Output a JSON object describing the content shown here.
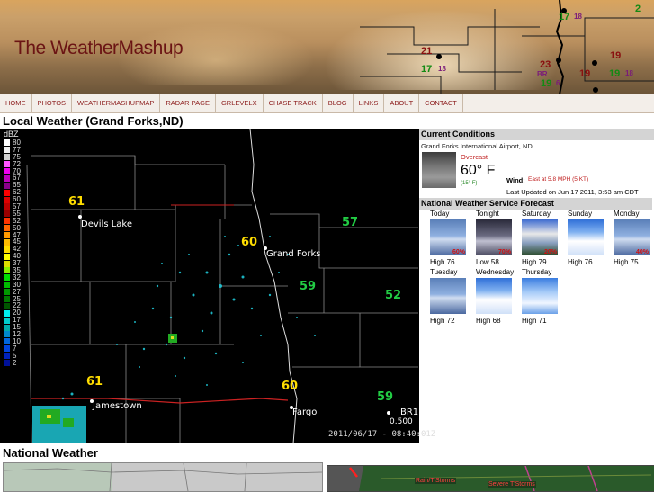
{
  "site": {
    "title": "The WeatherMashup"
  },
  "header_map": {
    "numbers": [
      {
        "text": "21",
        "color": "#8a1010"
      },
      {
        "text": "17",
        "color": "#138a13"
      },
      {
        "text": "18",
        "color": "#7a1a7a"
      },
      {
        "text": "23",
        "color": "#8a1010"
      },
      {
        "text": "BR",
        "color": "#7a1a7a"
      },
      {
        "text": "19",
        "color": "#138a13"
      },
      {
        "text": "6",
        "color": "#7a1a7a"
      },
      {
        "text": "19",
        "color": "#8a1010"
      },
      {
        "text": "19",
        "color": "#8a1010"
      },
      {
        "text": "19",
        "color": "#138a13"
      },
      {
        "text": "18",
        "color": "#7a1a7a"
      },
      {
        "text": "17",
        "color": "#138a13"
      },
      {
        "text": "18",
        "color": "#7a1a7a"
      },
      {
        "text": "2",
        "color": "#138a13"
      }
    ]
  },
  "nav": {
    "items": [
      "HOME",
      "PHOTOS",
      "WEATHERMASHUPMAP",
      "RADAR PAGE",
      "GRLEVELX",
      "CHASE TRACK",
      "BLOG",
      "LINKS",
      "ABOUT",
      "CONTACT"
    ]
  },
  "local": {
    "title": "Local Weather (Grand Forks,ND)",
    "radar": {
      "units": "dBZ",
      "legend": [
        {
          "v": "80",
          "c": "#ffffff"
        },
        {
          "v": "77",
          "c": "#f0f0f0"
        },
        {
          "v": "75",
          "c": "#d0d0d0"
        },
        {
          "v": "72",
          "c": "#ff55ff"
        },
        {
          "v": "70",
          "c": "#ee00ee"
        },
        {
          "v": "67",
          "c": "#bb00bb"
        },
        {
          "v": "65",
          "c": "#880088"
        },
        {
          "v": "62",
          "c": "#ff0000"
        },
        {
          "v": "60",
          "c": "#dd0000"
        },
        {
          "v": "57",
          "c": "#bb0000"
        },
        {
          "v": "55",
          "c": "#990000"
        },
        {
          "v": "52",
          "c": "#ff3300"
        },
        {
          "v": "50",
          "c": "#ff6600"
        },
        {
          "v": "47",
          "c": "#ff9900"
        },
        {
          "v": "45",
          "c": "#ffbb00"
        },
        {
          "v": "42",
          "c": "#ffdd00"
        },
        {
          "v": "40",
          "c": "#ffff00"
        },
        {
          "v": "37",
          "c": "#dddd00"
        },
        {
          "v": "35",
          "c": "#88ee00"
        },
        {
          "v": "32",
          "c": "#00dd00"
        },
        {
          "v": "30",
          "c": "#00bb00"
        },
        {
          "v": "27",
          "c": "#009900"
        },
        {
          "v": "25",
          "c": "#007700"
        },
        {
          "v": "22",
          "c": "#005500"
        },
        {
          "v": "20",
          "c": "#00eeee"
        },
        {
          "v": "17",
          "c": "#00cccc"
        },
        {
          "v": "15",
          "c": "#00aaaa"
        },
        {
          "v": "12",
          "c": "#0088cc"
        },
        {
          "v": "10",
          "c": "#0066dd"
        },
        {
          "v": "7",
          "c": "#0044dd"
        },
        {
          "v": "5",
          "c": "#0022bb"
        },
        {
          "v": "2",
          "c": "#001199"
        }
      ],
      "cities": [
        {
          "name": "Devils Lake"
        },
        {
          "name": "Grand Forks"
        },
        {
          "name": "Jamestown"
        },
        {
          "name": "Fargo"
        },
        {
          "name": "BR1"
        }
      ],
      "temps": [
        {
          "v": "61",
          "color": "#ffdd00"
        },
        {
          "v": "60",
          "color": "#ffdd00"
        },
        {
          "v": "57",
          "color": "#22cc44"
        },
        {
          "v": "59",
          "color": "#22cc44"
        },
        {
          "v": "52",
          "color": "#22cc44"
        },
        {
          "v": "61",
          "color": "#ffdd00"
        },
        {
          "v": "60",
          "color": "#ffdd00"
        },
        {
          "v": "59",
          "color": "#22cc44"
        }
      ],
      "timestamp": "2011/06/17 - 08:40:01Z",
      "extra_label": "0.500"
    }
  },
  "current": {
    "header": "Current Conditions",
    "station": "Grand Forks International Airport, ND",
    "condition": "Overcast",
    "temp": "60° F",
    "temp_c": "(15° F)",
    "wind_label": "Wind:",
    "wind": "East at 5.8 MPH (5 KT)",
    "updated": "Last Updated on Jun 17 2011, 3:53 am CDT"
  },
  "forecast": {
    "header": "National Weather Service Forecast",
    "days": [
      {
        "day": "Today",
        "high": "High 76",
        "pct": "60%",
        "icon": "thunderstorm-icon"
      },
      {
        "day": "Tonight",
        "high": "Low 58",
        "pct": "70%",
        "icon": "night-thunderstorm-icon"
      },
      {
        "day": "Saturday",
        "high": "High 79",
        "pct": "20%",
        "icon": "partly-cloudy-storm-icon"
      },
      {
        "day": "Sunday",
        "high": "High 76",
        "pct": "",
        "icon": "partly-cloudy-icon"
      },
      {
        "day": "Monday",
        "high": "High 75",
        "pct": "40%",
        "icon": "thunderstorm-icon"
      },
      {
        "day": "Tuesday",
        "high": "High 72",
        "pct": "",
        "icon": "thunderstorm-icon"
      },
      {
        "day": "Wednesday",
        "high": "High 68",
        "pct": "",
        "icon": "partly-cloudy-icon"
      },
      {
        "day": "Thursday",
        "high": "High 71",
        "pct": "",
        "icon": "sunny-cloudy-icon"
      }
    ]
  },
  "national": {
    "title": "National Weather",
    "sev_labels": [
      "Rain/T'Storms",
      "Severe T'Storms"
    ]
  }
}
